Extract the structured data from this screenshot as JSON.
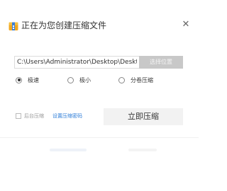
{
  "window": {
    "title": "正在为您创建压缩文件",
    "close_glyph": "✕"
  },
  "path": {
    "value": "C:\\Users\\Administrator\\Desktop\\Desktop",
    "choose_label": "选择位置"
  },
  "options": [
    {
      "label": "极速",
      "checked": true
    },
    {
      "label": "极小",
      "checked": false
    },
    {
      "label": "分卷压缩",
      "checked": false
    }
  ],
  "footer": {
    "background_label": "后台压缩",
    "background_checked": false,
    "password_link": "设置压缩密码",
    "compress_label": "立即压缩"
  },
  "colors": {
    "link": "#2f7ed8",
    "choose_button_bg": "#c8c8c8",
    "compress_button_bg": "#f2f2f2"
  },
  "icons": {
    "app": "archive-box-icon",
    "close": "close-icon"
  }
}
